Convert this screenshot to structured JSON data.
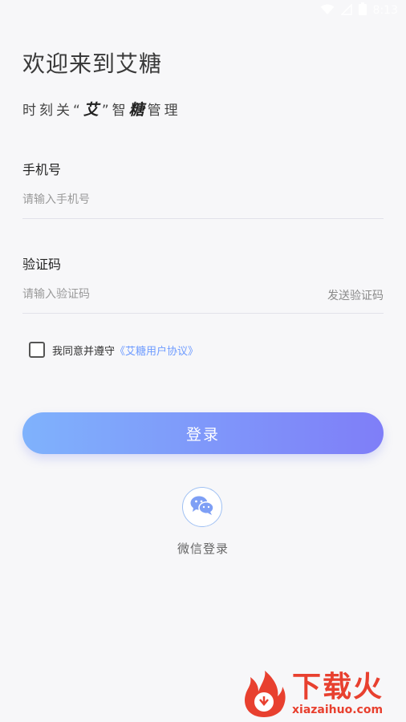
{
  "status_bar": {
    "time": "8:13",
    "icons": [
      "wifi-icon",
      "signal-icon",
      "battery-icon"
    ]
  },
  "header": {
    "title": "欢迎来到艾糖",
    "slogan_part1": "时刻关“",
    "slogan_ai": "艾",
    "slogan_part2": "”智",
    "slogan_tang": "糖",
    "slogan_part3": "管理"
  },
  "phone_field": {
    "label": "手机号",
    "placeholder": "请输入手机号",
    "value": ""
  },
  "code_field": {
    "label": "验证码",
    "placeholder": "请输入验证码",
    "value": "",
    "send_label": "发送验证码"
  },
  "agreement": {
    "checked": false,
    "text": "我同意并遵守",
    "link": "《艾糖用户协议》"
  },
  "login_button": {
    "label": "登录"
  },
  "wechat_login": {
    "label": "微信登录",
    "icon": "wechat-icon"
  },
  "watermark": {
    "cn": "下载火",
    "en": "xiazaihuo.com"
  },
  "colors": {
    "background": "#f7f7f9",
    "button_gradient_start": "#7fb2fc",
    "button_gradient_end": "#7f7ef8",
    "link": "#6f9cff",
    "watermark": "#e8402f"
  }
}
